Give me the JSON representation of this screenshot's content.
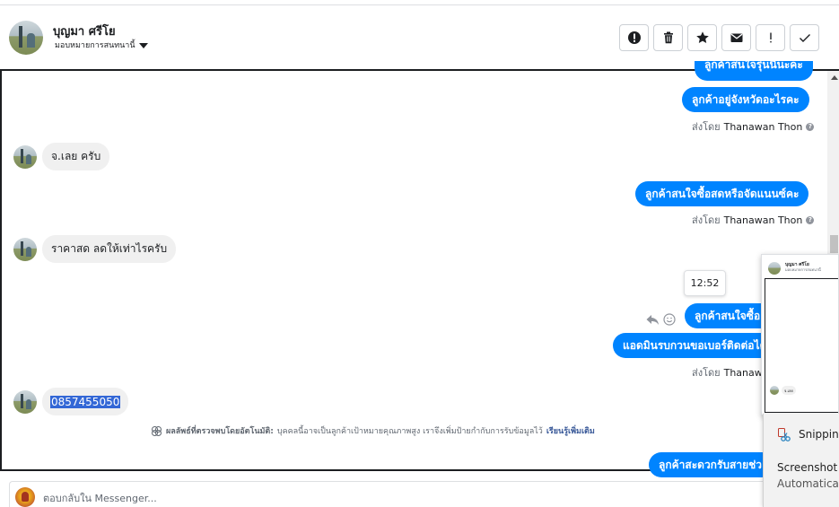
{
  "header": {
    "contact_name": "บุญมา ศรีโย",
    "assign_label": "มอบหมายการสนทนานี้",
    "buttons": [
      {
        "name": "spam-button",
        "icon": "alert-circle-icon"
      },
      {
        "name": "delete-button",
        "icon": "trash-icon"
      },
      {
        "name": "star-button",
        "icon": "star-icon"
      },
      {
        "name": "mark-unread-button",
        "icon": "envelope-icon"
      },
      {
        "name": "follow-up-button",
        "icon": "exclamation-icon"
      },
      {
        "name": "mark-done-button",
        "icon": "check-icon"
      }
    ]
  },
  "messages": {
    "out_1_partial": "ลูกค้าสนใจรุ่นนี้นะคะ",
    "out_2": "ลูกค้าอยู่จังหวัดอะไรคะ",
    "sent_by_label": "ส่งโดย",
    "agent_name": "Thanawan Thon",
    "in_1": "จ.เลย ครับ",
    "out_3": "ลูกค้าสนใจซื้อสดหรือจัดแนนซ์คะ",
    "in_2": "ราคาสด ลดให้เท่าไรครับ",
    "time_tooltip": "12:52",
    "out_4": "ลูกค้าสนใจซื้อ",
    "out_5": "แอดมินรบกวนขอเบอร์ติดต่อได",
    "in_3": "0857455050",
    "out_6": "ลูกค้าสะดวกรับสายช่ว",
    "agent_name_truncated": "Thanawa"
  },
  "notice": {
    "title": "ผลลัพธ์ที่ตรวจพบโดยอัตโนมัติ:",
    "body": "บุคคลนี้อาจเป็นลูกค้าเป้าหมายคุณภาพสูง เราจึงเพิ่มป้ายกำกับการรับข้อมูลไว้",
    "link": "เรียนรู้เพิ่มเติม"
  },
  "footer": {
    "reply_placeholder": "ตอบกลับใน Messenger..."
  },
  "preview": {
    "name": "บุญมา ศรีโย",
    "sub": "มอบหมายการสนทนานี้",
    "msg": "จ.เลย"
  },
  "snip": {
    "app": "Snipping",
    "title": "Screenshot",
    "body": "Automatica"
  },
  "colors": {
    "accent": "#0084ff",
    "incoming": "#f0f0f0",
    "link": "#385898",
    "selection": "#3367d6"
  }
}
